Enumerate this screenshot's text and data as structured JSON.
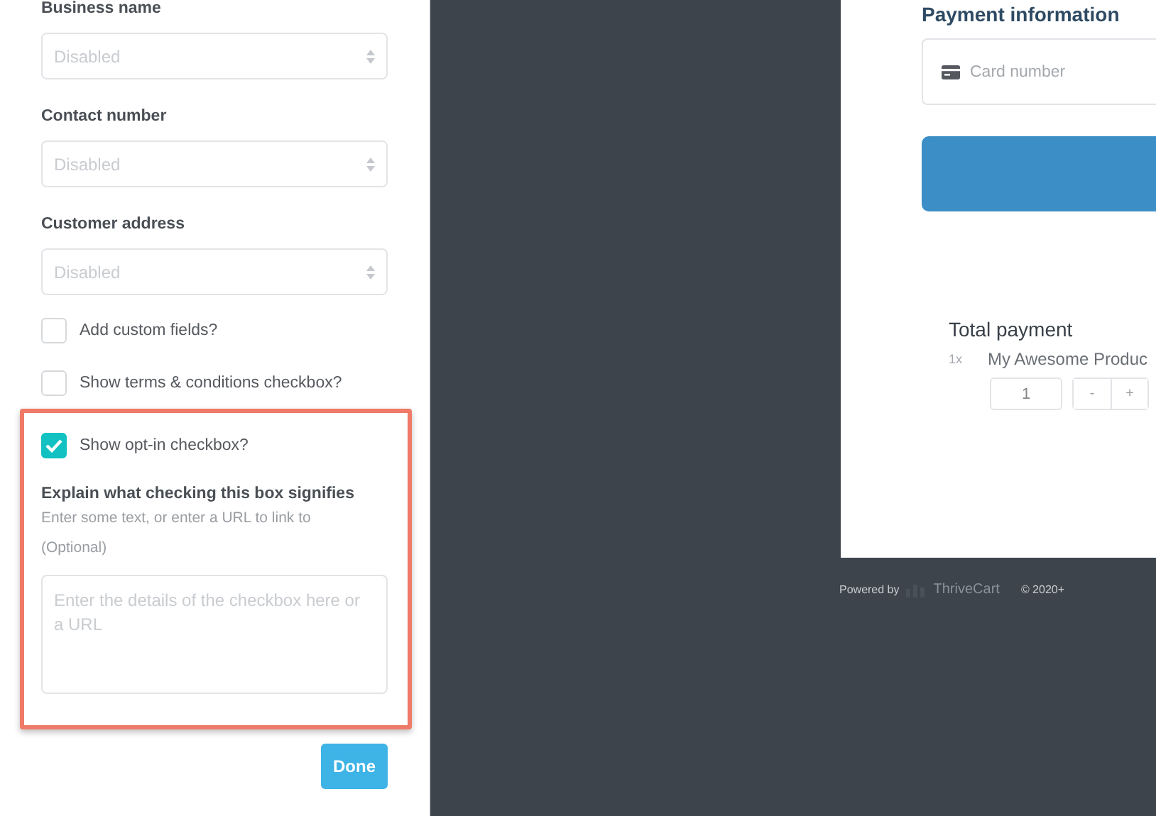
{
  "settings_panel": {
    "selects": [
      {
        "label": "Business name",
        "value": "Disabled"
      },
      {
        "label": "Contact number",
        "value": "Disabled"
      },
      {
        "label": "Customer address",
        "value": "Disabled"
      }
    ],
    "checkboxes": [
      {
        "label": "Add custom fields?",
        "checked": false
      },
      {
        "label": "Show terms & conditions checkbox?",
        "checked": false
      }
    ],
    "opt_in": {
      "label": "Show opt-in checkbox?",
      "checked": true,
      "heading": "Explain what checking this box signifies",
      "hint": "Enter some text, or enter a URL to link to",
      "optional": "(Optional)",
      "placeholder": "Enter the details of the checkbox here or a URL"
    },
    "done_button": "Done"
  },
  "checkout_preview": {
    "payment_heading": "Payment information",
    "card_placeholder": "Card number",
    "total_heading": "Total payment",
    "quantity_prefix": "1x",
    "product": "My Awesome Produc",
    "quantity": "1",
    "minus": "-",
    "plus": "+"
  },
  "footer": {
    "powered_by": "Powered by",
    "brand": "ThriveCart",
    "copyright": "© 2020+"
  }
}
